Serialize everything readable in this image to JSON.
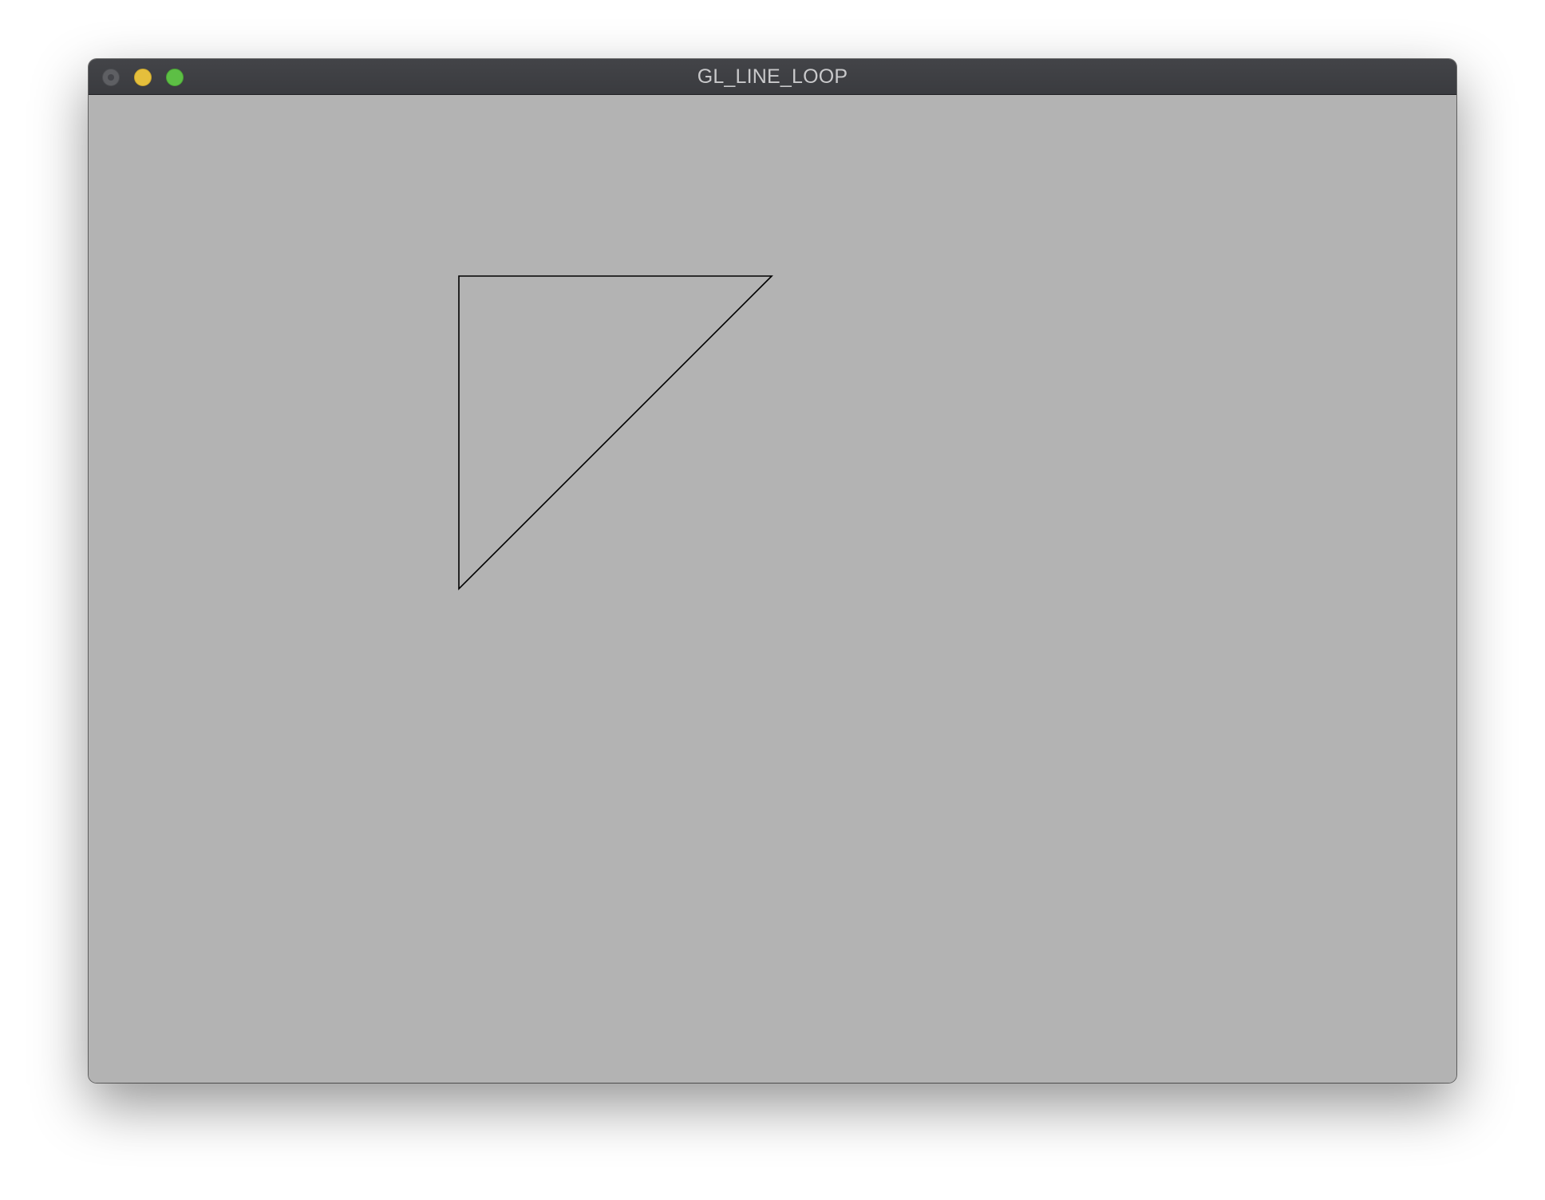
{
  "window": {
    "title": "GL_LINE_LOOP"
  },
  "icons": {
    "close": "close-icon",
    "minimize": "minimize-icon",
    "zoom": "zoom-icon"
  },
  "colors": {
    "titlebar": "#3d3e42",
    "title_text": "#c9c9cb",
    "canvas_background": "#b3b3b3",
    "line": "#000000",
    "close_button": "#5e5f63",
    "minimize_button": "#e5bf3c",
    "zoom_button": "#5dbf45"
  }
}
